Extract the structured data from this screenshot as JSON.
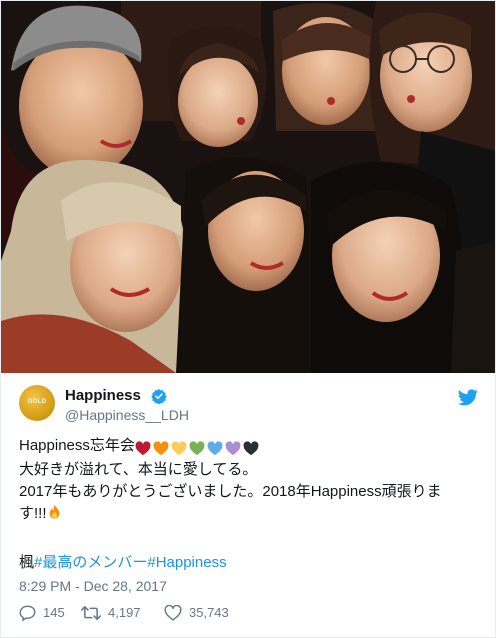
{
  "tweet": {
    "display_name": "Happiness",
    "handle": "@Happiness__LDH",
    "avatar_text": "GOLD",
    "line1_text": "Happiness忘年会",
    "line2_text": "大好きが溢れて、本当に愛してる。",
    "line3_text": "2017年もありがとうございました。2018年Happiness頑張りま",
    "line4_text": "す!!!",
    "tag_prefix": "楓",
    "tag1": "#最高のメンバー",
    "tag2": "#Happiness",
    "timestamp": "8:29 PM - Dec 28, 2017",
    "replies": "145",
    "retweets": "4,197",
    "likes": "35,743"
  },
  "icons": {
    "verified": "verified-badge-icon",
    "brand": "twitter-bird-icon",
    "reply": "reply-icon",
    "retweet": "retweet-icon",
    "like": "heart-outline-icon",
    "fire": "fire-emoji-icon"
  },
  "colors": {
    "accent": "#1da1f2",
    "link": "#1b95e0",
    "muted": "#657786",
    "hearts": [
      "#be1931",
      "#f4900c",
      "#fdcb58",
      "#77b255",
      "#5dadec",
      "#aa8ed6",
      "#292f33"
    ]
  }
}
